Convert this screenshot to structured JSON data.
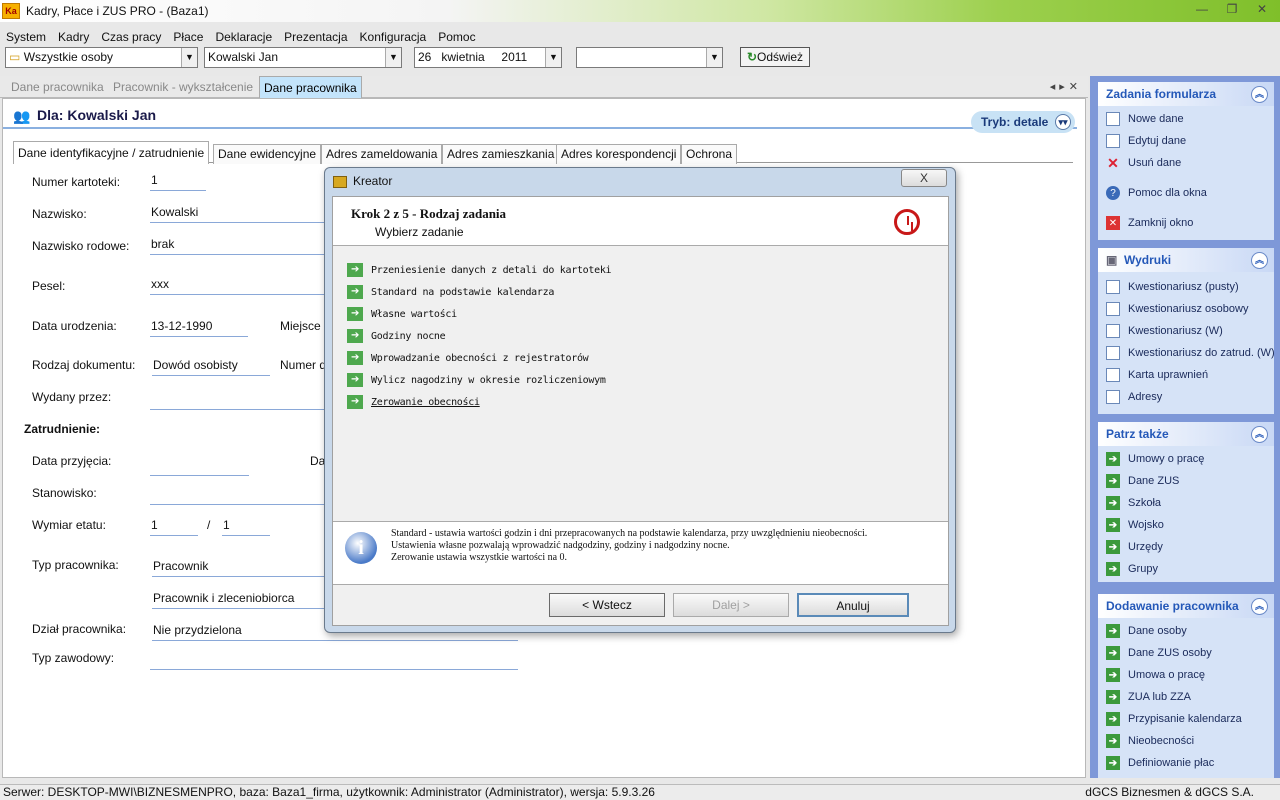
{
  "window": {
    "title": "Kadry, Płace i ZUS PRO - (Baza1)",
    "logo_text": "Ka",
    "minimize": "—",
    "maximize": "❐",
    "close": "✕"
  },
  "menu": [
    "System",
    "Kadry",
    "Czas pracy",
    "Płace",
    "Deklaracje",
    "Prezentacja",
    "Konfiguracja",
    "Pomoc"
  ],
  "toolbar": {
    "filter": "Wszystkie osoby",
    "person": "Kowalski Jan",
    "day": "26",
    "month": "kwietnia",
    "year": "2011",
    "extra": "",
    "refresh_label": "Odśwież"
  },
  "doc_tabs": [
    "Dane pracownika",
    "Pracownik - wykształcenie",
    "Dane pracownika"
  ],
  "header": {
    "title": "Dla: Kowalski Jan",
    "mode": "Tryb: detale"
  },
  "form_tabs": [
    "Dane identyfikacyjne / zatrudnienie",
    "Dane ewidencyjne",
    "Adres zameldowania",
    "Adres zamieszkania",
    "Adres korespondencji",
    "Ochrona"
  ],
  "form": {
    "numer_kartoteki": {
      "label": "Numer kartoteki:",
      "value": "1"
    },
    "nazwisko": {
      "label": "Nazwisko:",
      "value": "Kowalski"
    },
    "nazwisko_rodowe": {
      "label": "Nazwisko rodowe:",
      "value": "brak"
    },
    "pesel": {
      "label": "Pesel:",
      "value": "xxx"
    },
    "data_urodzenia": {
      "label": "Data urodzenia:",
      "value": "13-12-1990"
    },
    "miejsce_label": "Miejsce",
    "rodzaj_dokumentu": {
      "label": "Rodzaj dokumentu:",
      "value": "Dowód osobisty"
    },
    "numer_label": "Numer d",
    "wydany_przez": {
      "label": "Wydany przez:",
      "value": ""
    },
    "zatrudnienie": "Zatrudnienie:",
    "data_przyjecia": {
      "label": "Data przyjęcia:",
      "value": ""
    },
    "da_label": "Da",
    "stanowisko": {
      "label": "Stanowisko:",
      "value": ""
    },
    "wymiar_etatu": {
      "label": "Wymiar etatu:",
      "value1": "1",
      "sep": "/",
      "value2": "1"
    },
    "typ_pracownika": {
      "label": "Typ pracownika:",
      "value": "Pracownik",
      "value2": "Pracownik i zleceniobiorca"
    },
    "dzial": {
      "label": "Dział pracownika:",
      "value": "Nie przydzielona"
    },
    "typ_zawodowy": {
      "label": "Typ zawodowy:",
      "value": ""
    }
  },
  "dialog": {
    "title": "Kreator",
    "close": "X",
    "step": "Krok 2 z 5 - Rodzaj zadania",
    "subtitle": "Wybierz zadanie",
    "options": [
      "Przeniesienie danych z detali do kartoteki",
      "Standard na podstawie kalendarza",
      "Własne wartości",
      "Godziny nocne",
      "Wprowadzanie obecności z rejestratorów",
      "Wylicz nagodziny w okresie rozliczeniowym",
      "Zerowanie obecności"
    ],
    "info": [
      "Standard - ustawia wartości godzin i dni przepracowanych na podstawie kalendarza, przy uwzględnieniu nieobecności.",
      "Ustawienia własne pozwalają wprowadzić nadgodziny, godziny i nadgodziny nocne.",
      "Zerowanie ustawia wszystkie wartości na 0."
    ],
    "info_icon": "i",
    "btn_back": "< Wstecz",
    "btn_next": "Dalej >",
    "btn_cancel": "Anuluj"
  },
  "taskpane": {
    "zadania": {
      "title": "Zadania formularza",
      "items": [
        "Nowe dane",
        "Edytuj dane",
        "Usuń dane",
        "Pomoc dla okna",
        "Zamknij okno"
      ]
    },
    "wydruki": {
      "title": "Wydruki",
      "items": [
        "Kwestionariusz (pusty)",
        "Kwestionariusz osobowy",
        "Kwestionariusz (W)",
        "Kwestionariusz do zatrud. (W)",
        "Karta uprawnień",
        "Adresy"
      ]
    },
    "patrz": {
      "title": "Patrz także",
      "items": [
        "Umowy o pracę",
        "Dane ZUS",
        "Szkoła",
        "Wojsko",
        "Urzędy",
        "Grupy"
      ]
    },
    "dodawanie": {
      "title": "Dodawanie pracownika",
      "items": [
        "Dane osoby",
        "Dane ZUS osoby",
        "Umowa o pracę",
        "ZUA lub ZZA",
        "Przypisanie kalendarza",
        "Nieobecności",
        "Definiowanie płac"
      ]
    }
  },
  "status": {
    "left": "Serwer: DESKTOP-MWI\\BIZNESMENPRO, baza: Baza1_firma, użytkownik: Administrator (Administrator), wersja: 5.9.3.26",
    "right": "dGCS Biznesmen & dGCS S.A."
  }
}
